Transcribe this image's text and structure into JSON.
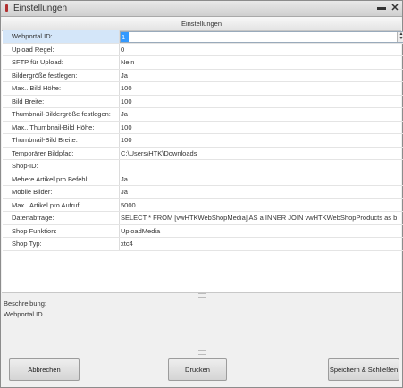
{
  "window": {
    "title": "Einstellungen",
    "minimize_glyph": "▬",
    "close_glyph": "✕"
  },
  "grid": {
    "header": "Einstellungen",
    "rows": [
      {
        "label": "Webportal ID:",
        "value": "1"
      },
      {
        "label": "Upload Regel:",
        "value": "0"
      },
      {
        "label": "SFTP für Upload:",
        "value": "Nein"
      },
      {
        "label": "Bildergröße festlegen:",
        "value": "Ja"
      },
      {
        "label": "Max.. Bild Höhe:",
        "value": "100"
      },
      {
        "label": "Bild Breite:",
        "value": "100"
      },
      {
        "label": "Thumbnail-Bildergröße festlegen:",
        "value": "Ja"
      },
      {
        "label": "Max.. Thumbnail-Bild Höhe:",
        "value": "100"
      },
      {
        "label": "Thumbnail-Bild Breite:",
        "value": "100"
      },
      {
        "label": "Temporärer Bildpfad:",
        "value": "C:\\Users\\HTK\\Downloads"
      },
      {
        "label": "Shop-ID:",
        "value": ""
      },
      {
        "label": "Mehere Artikel pro Befehl:",
        "value": "Ja"
      },
      {
        "label": "Mobile Bilder:",
        "value": "Ja"
      },
      {
        "label": "Max.. Artikel pro Aufruf:",
        "value": "5000"
      },
      {
        "label": "Datenabfrage:",
        "value": "SELECT * FROM [vwHTKWebShopMedia] AS a INNER JOIN vwHTKWebShopProducts as b ON a.Art..."
      },
      {
        "label": "Shop Funktion:",
        "value": "UploadMedia"
      },
      {
        "label": "Shop Typ:",
        "value": "xtc4"
      }
    ]
  },
  "description": {
    "title": "Beschreibung:",
    "text": "Webportal ID"
  },
  "buttons": {
    "cancel": "Abbrechen",
    "print": "Drucken",
    "save_close": "Speichern & Schließen"
  },
  "colors": {
    "selected_row": "#d4e6f9",
    "selection_highlight": "#3399ff"
  }
}
